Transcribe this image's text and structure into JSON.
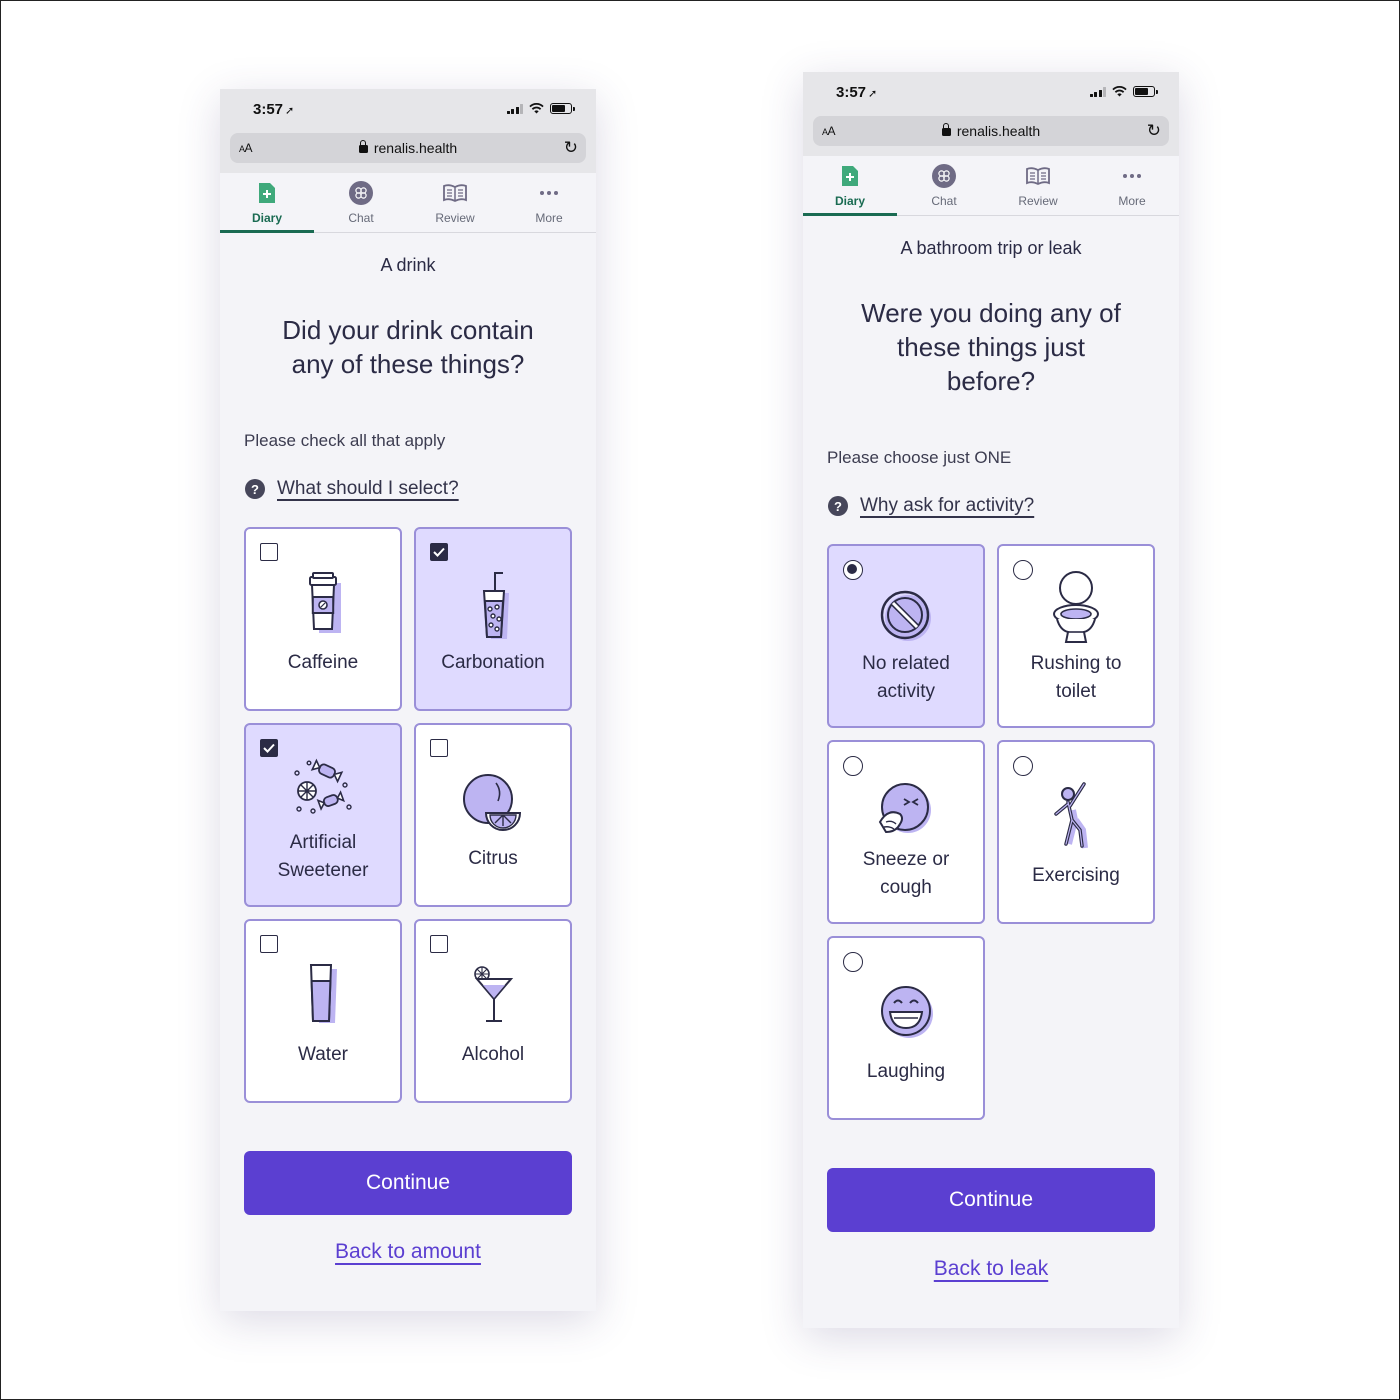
{
  "status": {
    "time": "3:57"
  },
  "browser": {
    "aa_small": "A",
    "aa_big": "A",
    "url": "renalis.health"
  },
  "nav": {
    "tabs": [
      {
        "label": "Diary"
      },
      {
        "label": "Chat"
      },
      {
        "label": "Review"
      },
      {
        "label": "More"
      }
    ],
    "active_color": "#1a6b52"
  },
  "left": {
    "eyebrow": "A drink",
    "question_line1": "Did your drink contain",
    "question_line2": "any of these things?",
    "instruction": "Please check all that apply",
    "help_link": "What should I select?",
    "options": [
      {
        "label": "Caffeine",
        "selected": false
      },
      {
        "label": "Carbonation",
        "selected": true
      },
      {
        "label_line1": "Artificial",
        "label_line2": "Sweetener",
        "selected": true
      },
      {
        "label": "Citrus",
        "selected": false
      },
      {
        "label": "Water",
        "selected": false
      },
      {
        "label": "Alcohol",
        "selected": false
      }
    ],
    "continue": "Continue",
    "back": "Back to amount"
  },
  "right": {
    "eyebrow": "A bathroom trip or leak",
    "question_line1": "Were you doing any of",
    "question_line2": "these things just",
    "question_line3": "before?",
    "instruction": "Please choose just ONE",
    "help_link": "Why ask for activity?",
    "options": [
      {
        "label_line1": "No related",
        "label_line2": "activity",
        "selected": true
      },
      {
        "label_line1": "Rushing to",
        "label_line2": "toilet",
        "selected": false
      },
      {
        "label_line1": "Sneeze or",
        "label_line2": "cough",
        "selected": false
      },
      {
        "label": "Exercising",
        "selected": false
      },
      {
        "label": "Laughing",
        "selected": false
      }
    ],
    "continue": "Continue",
    "back": "Back to leak"
  },
  "colors": {
    "primary": "#5b3fd1",
    "selected_card": "#dfdaff",
    "card_border": "#9a8fd8",
    "icon_fill": "#bdb4f2"
  },
  "icons": [
    "diary-icon",
    "chat-icon",
    "review-icon",
    "more-icon",
    "caffeine-icon",
    "carbonation-icon",
    "sweetener-icon",
    "citrus-icon",
    "water-icon",
    "alcohol-icon",
    "no-activity-icon",
    "toilet-icon",
    "sneeze-icon",
    "exercise-icon",
    "laughing-icon"
  ]
}
